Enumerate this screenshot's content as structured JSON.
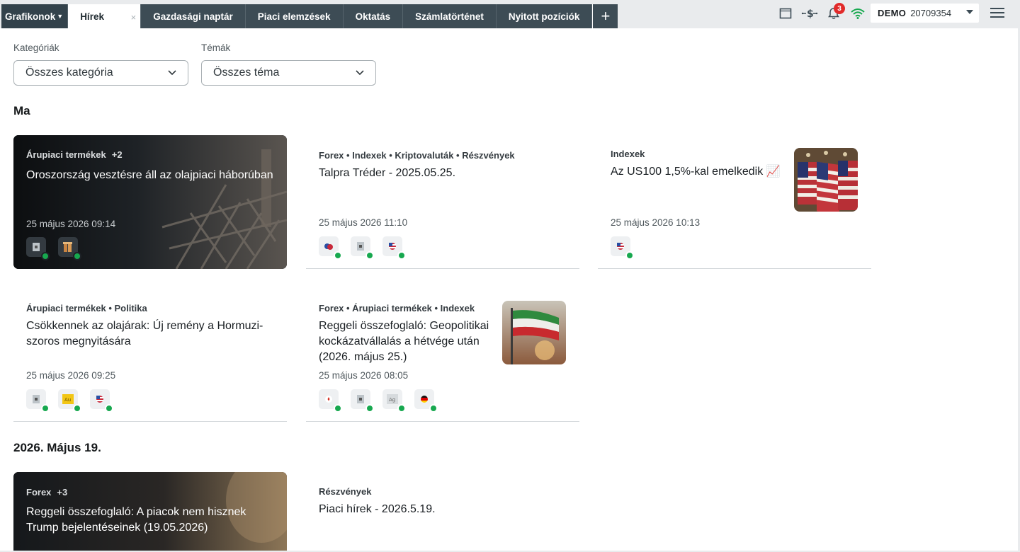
{
  "tabs": {
    "menu_label": "Grafikonok",
    "active_label": "Hírek",
    "items": [
      "Gazdasági naptár",
      "Piaci elemzések",
      "Oktatás",
      "Számlatörténet",
      "Nyitott pozíciók"
    ],
    "add_symbol": "+",
    "close_symbol": "×"
  },
  "toolbar": {
    "notification_count": "3",
    "account_mode": "DEMO",
    "account_number": "20709354",
    "icons": [
      "window-icon",
      "dollar-transfer-icon",
      "bell-icon",
      "wifi-icon",
      "hamburger-menu-icon"
    ],
    "wifi_color": "#17a84f"
  },
  "filters": {
    "category_label": "Kategóriák",
    "category_value": "Összes kategória",
    "topic_label": "Témák",
    "topic_value": "Összes téma"
  },
  "sections": [
    {
      "title": "Ma",
      "cards": [
        {
          "style": "dark",
          "categories": "Árupiaci termékek",
          "more": "+2",
          "headline": "Oroszország vesztésre áll az olajpiaci háborúban",
          "date": "25 május 2026 09:14",
          "instruments": [
            "oil-icon",
            "copper-icon"
          ]
        },
        {
          "style": "light",
          "categories": "Forex • Indexek • Kriptovaluták • Részvények",
          "headline": "Talpra Tréder - 2025.05.25.",
          "date": "25 május 2026 11:10",
          "instruments": [
            "eu-us-flag-icon",
            "oil-icon",
            "us-flag-icon"
          ]
        },
        {
          "style": "light",
          "categories": "Indexek",
          "headline": "Az US100 1,5%-kal emelkedik 📈",
          "date": "25 május 2026 10:13",
          "instruments": [
            "us-flag-icon"
          ],
          "thumbnail": "american-flags-image"
        },
        {
          "style": "light",
          "categories": "Árupiaci termékek • Politika",
          "headline": "Csökkennek az olajárak: Új remény a Hormuzi-szoros megnyitására",
          "date": "25 május 2026 09:25",
          "instruments": [
            "oil-icon",
            "gold-icon",
            "us-flag-icon"
          ]
        },
        {
          "style": "light",
          "categories": "Forex • Árupiaci termékek • Indexek",
          "headline": "Reggeli összefoglaló: Geopolitikai kockázatvállalás a hétvége után (2026. május 25.)",
          "date": "25 május 2026 08:05",
          "instruments": [
            "ca-flag-icon",
            "oil-icon",
            "silver-icon",
            "de-flag-icon"
          ],
          "thumbnail": "iran-flag-image"
        }
      ]
    },
    {
      "title": "2026. Május 19.",
      "cards": [
        {
          "style": "dark",
          "categories": "Forex",
          "more": "+3",
          "headline": "Reggeli összefoglaló: A piacok nem hisznek Trump bejelentéseinek (19.05.2026)"
        },
        {
          "style": "light",
          "categories": "Részvények",
          "headline": "Piaci hírek - 2026.5.19."
        }
      ]
    }
  ]
}
